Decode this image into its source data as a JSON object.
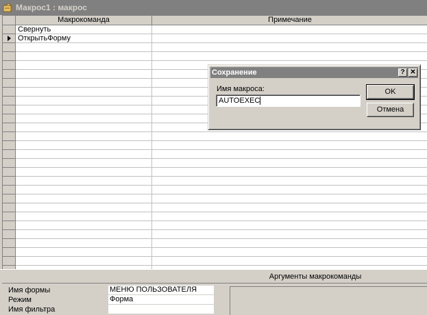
{
  "window": {
    "title": "Макрос1 : макрос"
  },
  "grid": {
    "col_action": "Макрокоманда",
    "col_comment": "Примечание",
    "rows": [
      "Свернуть",
      "ОткрытьФорму",
      "",
      "",
      "",
      "",
      "",
      "",
      "",
      "",
      "",
      "",
      "",
      "",
      "",
      "",
      "",
      "",
      "",
      "",
      "",
      "",
      "",
      "",
      "",
      "",
      "",
      ""
    ]
  },
  "args": {
    "title": "Аргументы макрокоманды",
    "items": [
      {
        "label": "Имя формы",
        "value": "МЕНЮ ПОЛЬЗОВАТЕЛЯ"
      },
      {
        "label": "Режим",
        "value": "Форма"
      },
      {
        "label": "Имя фильтра",
        "value": ""
      }
    ]
  },
  "dialog": {
    "title": "Сохранение",
    "help_label": "?",
    "close_label": "✕",
    "field_label": "Имя макроса:",
    "field_value": "AUTOEXEC",
    "ok_label": "OK",
    "cancel_label": "Отмена"
  }
}
